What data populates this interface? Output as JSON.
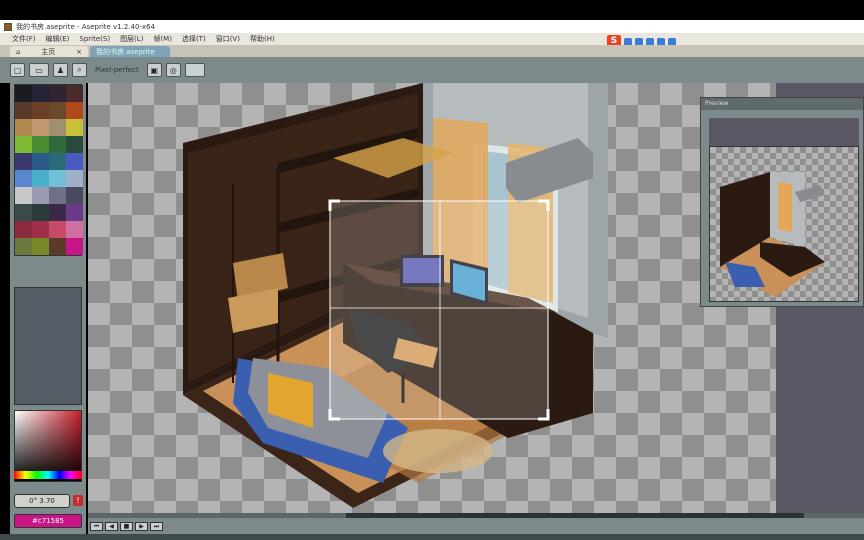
{
  "window": {
    "title": "我的书房.aseprite - Aseprite v1.2.40-x64"
  },
  "menu": [
    "文件(F)",
    "编辑(E)",
    "Sprite(S)",
    "图层(L)",
    "帧(M)",
    "选择(T)",
    "窗口(V)",
    "帮助(H)"
  ],
  "ime": {
    "brand": "S"
  },
  "tabs": {
    "home": "主页",
    "home_close": "×",
    "file": "我的书房.aseprite"
  },
  "toolbar": {
    "pixel_perfect": "Pixel-perfect"
  },
  "palette": [
    "#1b1b22",
    "#252436",
    "#2f2430",
    "#4a2a2a",
    "#5a3a2a",
    "#6b3e2a",
    "#6a4a2a",
    "#b04a1c",
    "#b08850",
    "#c09870",
    "#a09070",
    "#c8c036",
    "#7fb832",
    "#4a8c32",
    "#2e6a3a",
    "#2a4a3a",
    "#3a3a70",
    "#2a5a88",
    "#2a6a7a",
    "#4a5ac0",
    "#5a88d0",
    "#4ab0c8",
    "#70c0d8",
    "#a0b0c8",
    "#c8c8c8",
    "#9a9ab0",
    "#707088",
    "#4a4a60",
    "#3a4a4a",
    "#2a3a3a",
    "#3a2a4a",
    "#6a3a88",
    "#8a2a3a",
    "#a0304a",
    "#c84a6a",
    "#d070a0",
    "#6a7a3a",
    "#7a8a2a",
    "#5a3a2a",
    "#c71585"
  ],
  "status": {
    "coords": "0° 3.70",
    "warn": "!",
    "hex": "#c71585"
  },
  "preview": {
    "title": "Preview"
  },
  "colors": {
    "accent": "#c71585",
    "panel": "#7d8a8c"
  }
}
